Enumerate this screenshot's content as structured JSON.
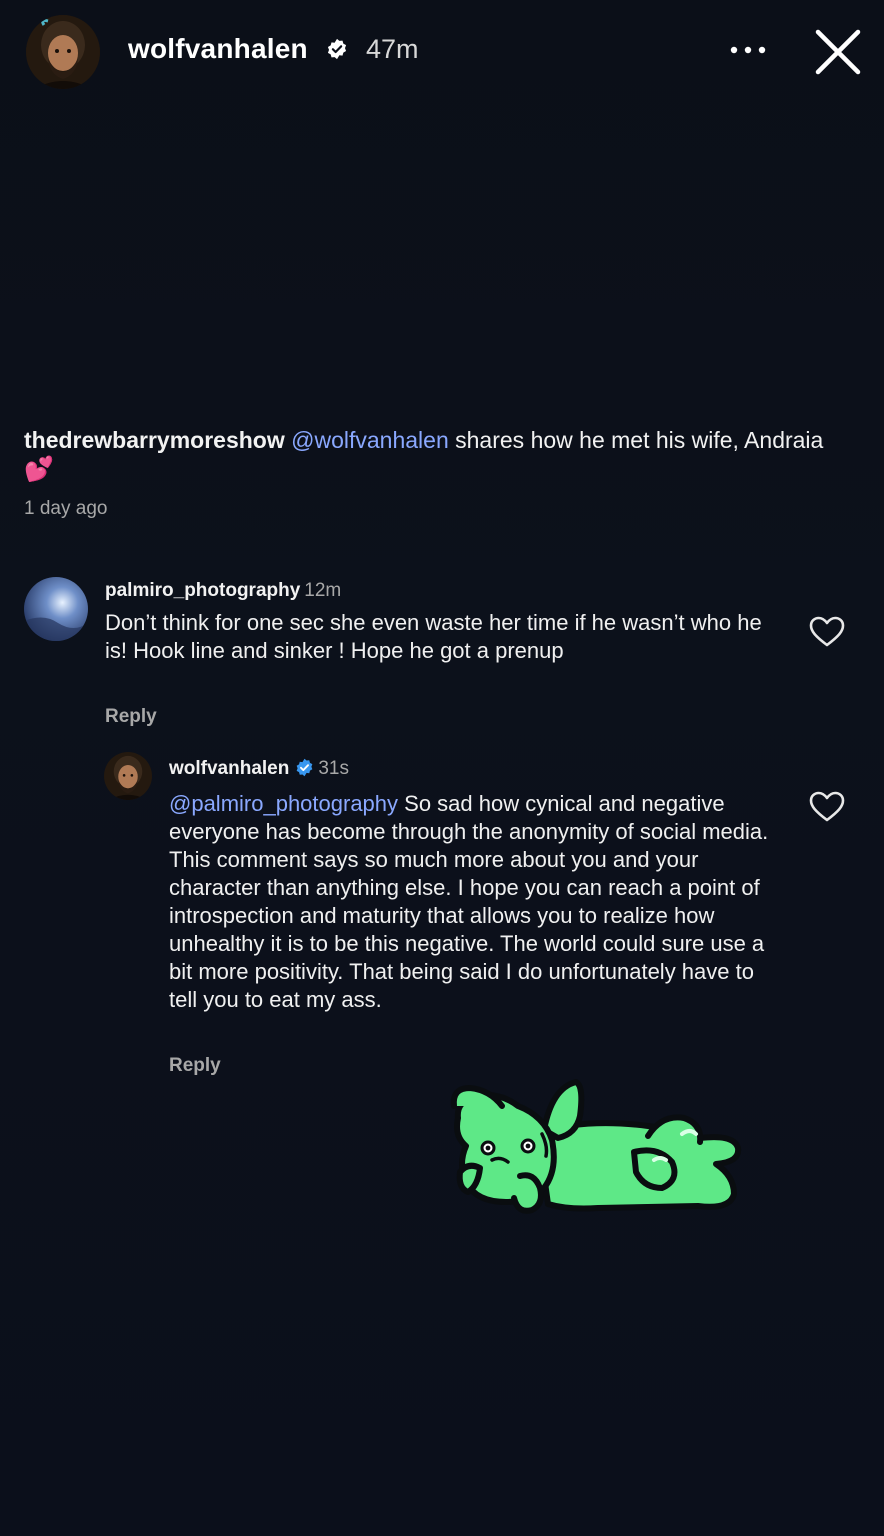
{
  "story": {
    "username": "wolfvanhalen",
    "time_ago": "47m"
  },
  "post": {
    "owner": "thedrewbarrymoreshow",
    "mention": "@wolfvanhalen",
    "caption_text": " shares how he met his wife, Andraia ",
    "emoji": "💕",
    "time_ago": "1 day ago"
  },
  "comments": [
    {
      "username": "palmiro_photography",
      "time_ago": "12m",
      "text": "Don’t think for one sec she even waste her time if he wasn’t who he is!  Hook line and sinker ! Hope he got a prenup",
      "reply_label": "Reply"
    },
    {
      "username": "wolfvanhalen",
      "time_ago": "31s",
      "mention": "@palmiro_photography",
      "text": " So sad how cynical and negative everyone has become through the anonymity of social media. This comment says so much more about you and your character than anything else. I hope you can reach a point of introspection and maturity that allows you to realize how unhealthy it is to be this negative. The world could sure use a bit more positivity. That being said I do unfortunately have to tell you to eat my ass.",
      "reply_label": "Reply"
    }
  ],
  "colors": {
    "background": "#0c101a",
    "mention": "#8aa8ff",
    "verified": "#3897f0",
    "sticker_green": "#5ee887"
  },
  "icons": {
    "more": "more-horizontal-icon",
    "close": "close-icon",
    "like": "heart-outline-icon",
    "verified": "verified-badge-icon"
  }
}
